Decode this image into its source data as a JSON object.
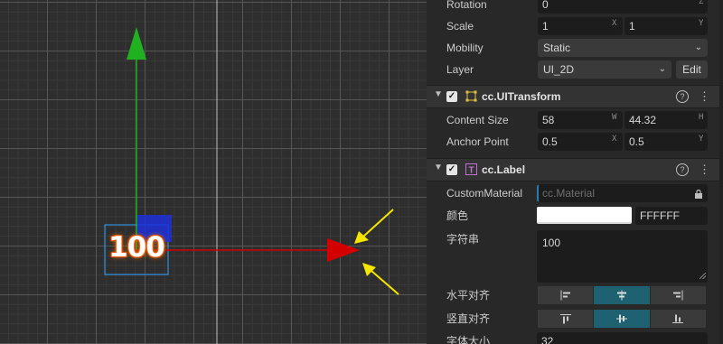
{
  "scene": {
    "label_text": "100"
  },
  "inspector": {
    "node": {
      "rotation": {
        "label": "Rotation",
        "value": "0",
        "axis": "Z"
      },
      "scale": {
        "label": "Scale",
        "x": "1",
        "x_axis": "X",
        "y": "1",
        "y_axis": "Y"
      },
      "mobility": {
        "label": "Mobility",
        "value": "Static"
      },
      "layer": {
        "label": "Layer",
        "value": "UI_2D",
        "edit": "Edit"
      }
    },
    "ui_transform": {
      "title": "cc.UITransform",
      "content_size": {
        "label": "Content Size",
        "w": "58",
        "w_axis": "W",
        "h": "44.32",
        "h_axis": "H"
      },
      "anchor_point": {
        "label": "Anchor Point",
        "x": "0.5",
        "x_axis": "X",
        "y": "0.5",
        "y_axis": "Y"
      }
    },
    "label": {
      "title": "cc.Label",
      "custom_material": {
        "label": "CustomMaterial",
        "placeholder": "cc.Material"
      },
      "color": {
        "label": "颜色",
        "hex": "FFFFFF",
        "swatch": "#ffffff"
      },
      "string": {
        "label": "字符串",
        "value": "100"
      },
      "h_align": {
        "label": "水平对齐",
        "active_index": 1
      },
      "v_align": {
        "label": "竖直对齐",
        "active_index": 1
      },
      "font_size": {
        "label": "字体大小",
        "value": "32"
      }
    }
  },
  "colors": {
    "accent": "#1e6271",
    "gizmo_x": "#d40000",
    "gizmo_y": "#1fb11f",
    "annotation_arrow": "#f5e600"
  }
}
